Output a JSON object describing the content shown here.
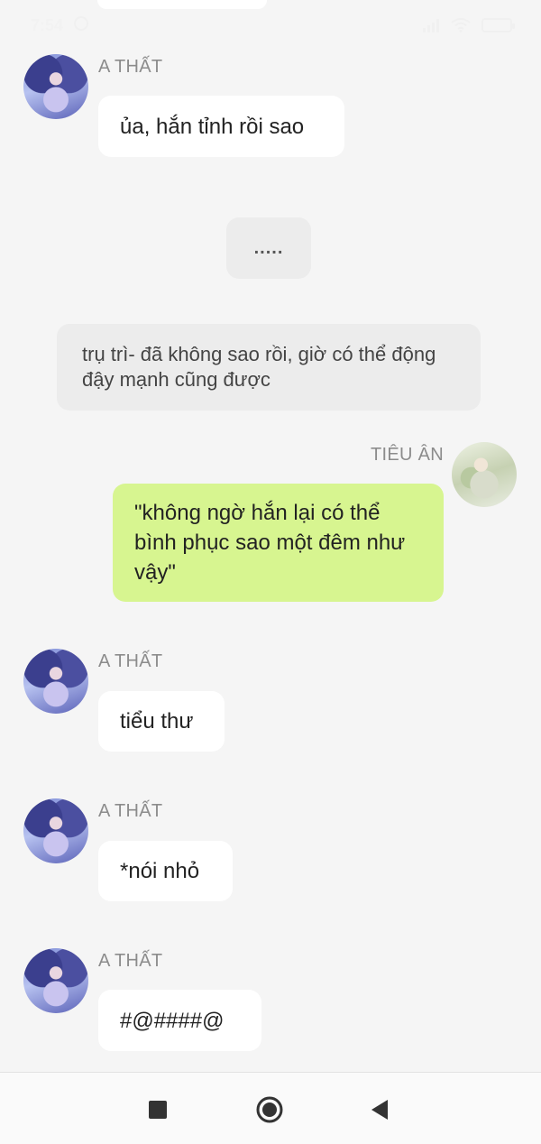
{
  "status_bar": {
    "time": "7:54",
    "icons": [
      "notification-icon",
      "signal-icon",
      "wifi-icon",
      "battery-icon"
    ]
  },
  "messages": [
    {
      "sender": "A THẤT",
      "text": "ủa, hắn tỉnh rồi sao",
      "side": "left",
      "avatar": "girl-avatar"
    },
    {
      "text": ".....",
      "type": "ellipsis"
    },
    {
      "text": "trụ trì- đã không sao rồi, giờ có thể động đậy mạnh cũng được",
      "type": "system"
    },
    {
      "sender": "TIÊU ÂN",
      "text": "\"không ngờ hắn lại có thể bình phục sao một đêm như vậy\"",
      "side": "right",
      "avatar": "robed-figure-avatar"
    },
    {
      "sender": "A THẤT",
      "text": "tiểu thư",
      "side": "left",
      "avatar": "girl-avatar"
    },
    {
      "sender": "A THẤT",
      "text": "*nói nhỏ",
      "side": "left",
      "avatar": "girl-avatar"
    },
    {
      "sender": "A THẤT",
      "text": "#@####@",
      "side": "left",
      "avatar": "girl-avatar"
    }
  ],
  "colors": {
    "background": "#f5f5f5",
    "bubble_left": "#ffffff",
    "bubble_right": "#d7f590",
    "system_bubble": "#ececec",
    "sender_name": "#8c8c8c"
  },
  "nav_bar": {
    "buttons": [
      "recent-apps-icon",
      "home-icon",
      "back-icon"
    ]
  }
}
